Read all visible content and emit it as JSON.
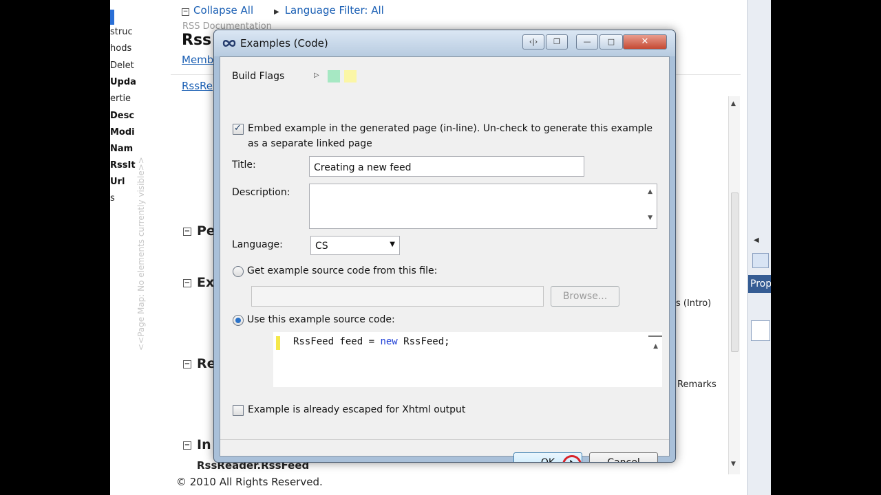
{
  "left_nav": {
    "items": [
      {
        "text": "struc",
        "bold": false
      },
      {
        "text": "hods",
        "bold": false
      },
      {
        "text": "Delet",
        "bold": false
      },
      {
        "text": "Upda",
        "bold": true
      },
      {
        "text": "ertie",
        "bold": false
      },
      {
        "text": "Desc",
        "bold": true
      },
      {
        "text": "Modi",
        "bold": true
      },
      {
        "text": "Nam",
        "bold": true
      },
      {
        "text": "RssIt",
        "bold": true
      },
      {
        "text": "Url",
        "bold": true
      },
      {
        "text": "s",
        "bold": false
      }
    ],
    "page_map": "<<Page Map: No elements currently visible>>"
  },
  "document": {
    "collapse_all": "Collapse All",
    "language_filter": "Language Filter: All",
    "doc_label": "RSS Documentation",
    "title_partial": "Rss",
    "members_link": "Memb",
    "rssre_link": "RssRe",
    "sections": [
      "Pe",
      "Ex",
      "Re",
      "In"
    ],
    "intro_fragment": "s (Intro)",
    "remarks_fragment": "Remarks",
    "rssfeed_heading": "RssReader.RssFeed",
    "copyright": "© 2010 All Rights Reserved."
  },
  "right_panel": {
    "properties_label": "Prop"
  },
  "dialog": {
    "title": "Examples (Code)",
    "build_flags_label": "Build Flags",
    "flag_colors": [
      "#a6e8c3",
      "#fbf6a6"
    ],
    "embed_checkbox": {
      "checked": true,
      "line1": "Embed example in the generated page (in-line). Un-check to generate this example",
      "line2": "as a separate linked page"
    },
    "title_label": "Title:",
    "title_value": "Creating a new feed",
    "description_label": "Description:",
    "description_value": "",
    "language_label": "Language:",
    "language_value": "CS",
    "file_radio_label": "Get example source code from this file:",
    "file_path_value": "",
    "browse_button": "Browse...",
    "code_radio_label": "Use this example source code:",
    "code": {
      "part1": "RssFeed feed = ",
      "keyword": "new",
      "part2": " RssFeed;"
    },
    "escaped_checkbox": {
      "checked": false,
      "label": "Example is already escaped for Xhtml output"
    },
    "ok_button": "OK",
    "cancel_button": "Cancel"
  }
}
